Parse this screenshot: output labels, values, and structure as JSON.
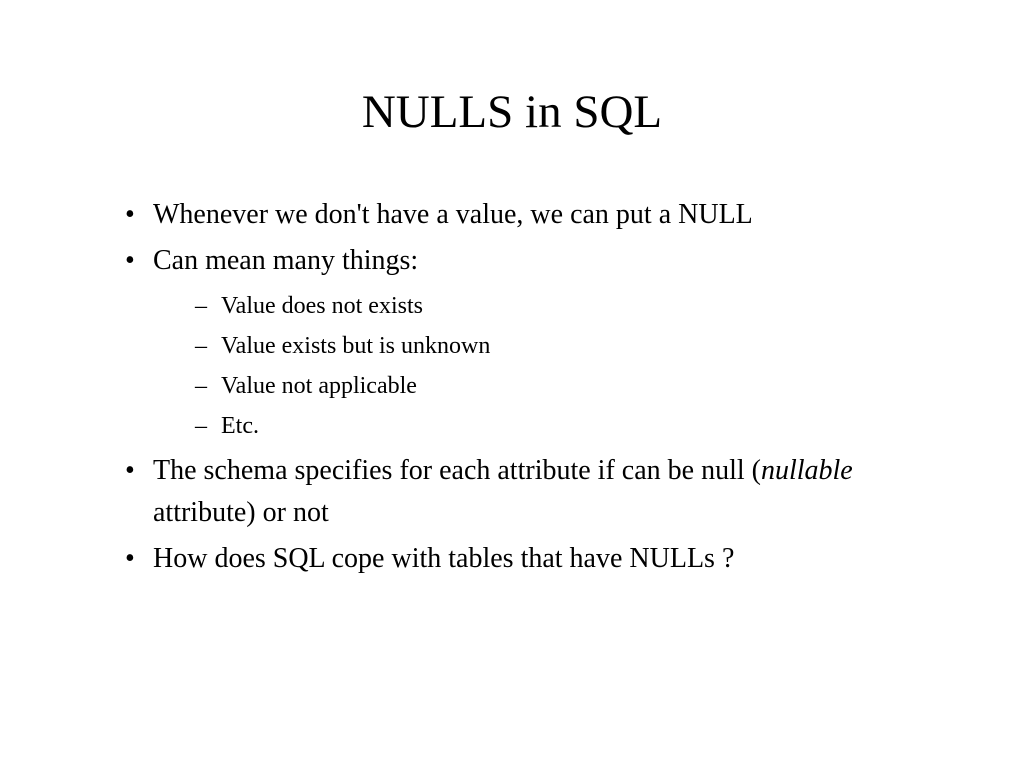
{
  "title": "NULLS in SQL",
  "bullets": {
    "b1": "Whenever we don't have a value, we can put a NULL",
    "b2": "Can mean many things:",
    "s1": "Value does not exists",
    "s2": "Value exists but is unknown",
    "s3": "Value not applicable",
    "s4": "Etc.",
    "b3_pre": "The schema specifies for each attribute if can be null (",
    "b3_italic": "nullable",
    "b3_post": " attribute) or not",
    "b4": "How does SQL cope with tables that have NULLs ?"
  }
}
